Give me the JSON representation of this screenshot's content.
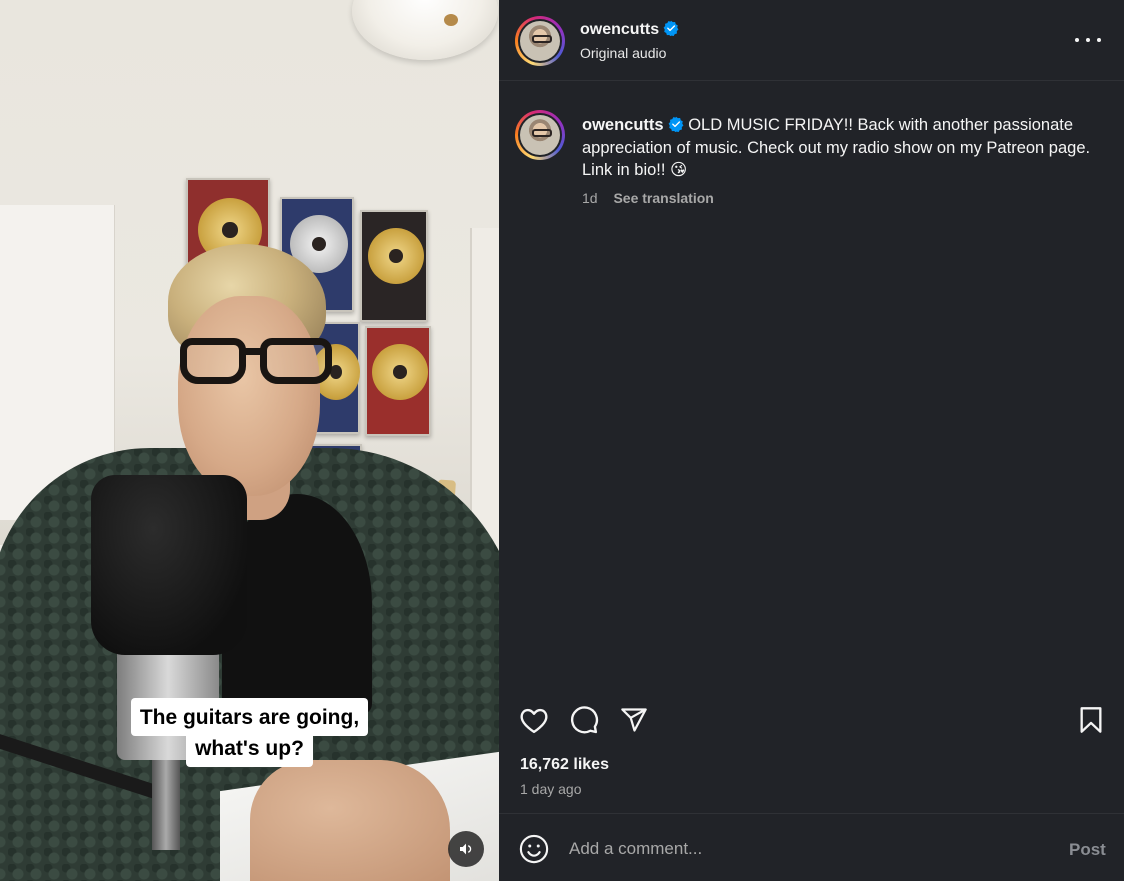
{
  "video": {
    "subtitle_line1": "The guitars are going,",
    "subtitle_line2": "what's up?",
    "sound_icon": "speaker-icon"
  },
  "header": {
    "username": "owencutts",
    "verified": true,
    "audio_label": "Original audio",
    "more_icon": "more-horizontal-icon"
  },
  "caption": {
    "username": "owencutts",
    "text": "OLD MUSIC FRIDAY!! Back with another passionate appreciation of music. Check out my radio show on my Patreon page. Link in bio!! 😘",
    "age": "1d",
    "see_translation": "See translation"
  },
  "actions": {
    "like_icon": "heart-icon",
    "comment_icon": "comment-icon",
    "share_icon": "share-icon",
    "save_icon": "bookmark-icon"
  },
  "stats": {
    "likes": "16,762 likes",
    "posted": "1 day ago"
  },
  "comment_box": {
    "placeholder": "Add a comment...",
    "post_label": "Post",
    "emoji_icon": "emoji-icon"
  },
  "colors": {
    "panel_bg": "#212328",
    "verified_blue": "#0095f6",
    "text_primary": "#f5f5f5",
    "text_secondary": "#a8a8a8"
  }
}
